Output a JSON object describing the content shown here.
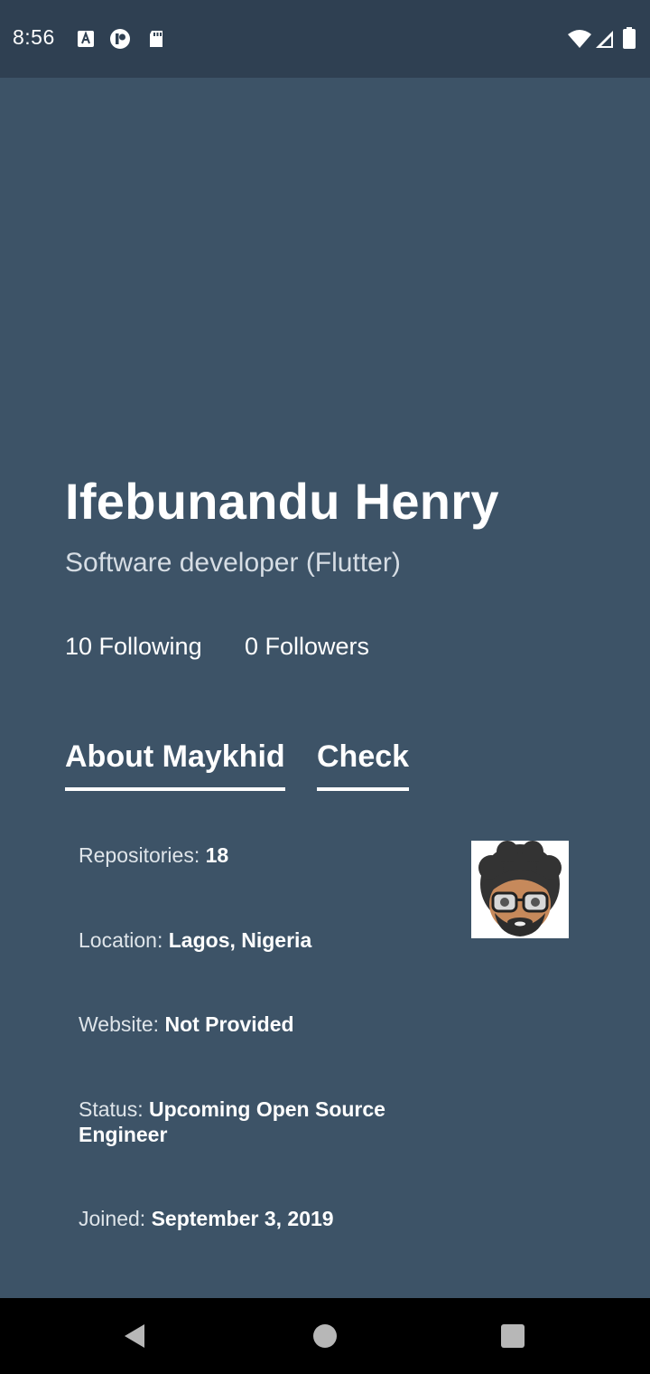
{
  "status_bar": {
    "time": "8:56",
    "left_icons": [
      "translate-icon",
      "app-icon",
      "sd-card-icon"
    ],
    "right_icons": [
      "wifi-icon",
      "signal-icon",
      "battery-icon"
    ]
  },
  "profile": {
    "name": "Ifebunandu Henry",
    "subtitle": "Software developer (Flutter)",
    "following": "10 Following",
    "followers": "0 Followers"
  },
  "tabs": [
    {
      "label": "About Maykhid"
    },
    {
      "label": "Check"
    }
  ],
  "details": {
    "repositories": {
      "label": "Repositories: ",
      "value": "18"
    },
    "location": {
      "label": "Location: ",
      "value": "Lagos, Nigeria"
    },
    "website": {
      "label": "Website: ",
      "value": "Not Provided"
    },
    "status": {
      "label": "Status: ",
      "value": "Upcoming Open Source Engineer"
    },
    "joined": {
      "label": "Joined: ",
      "value": "September 3, 2019"
    }
  },
  "colors": {
    "background": "#3d5367",
    "status_bar": "#2f4052",
    "nav_bar": "#000000",
    "text": "#ffffff"
  },
  "nav_icons": [
    "back-icon",
    "home-icon",
    "recents-icon"
  ]
}
